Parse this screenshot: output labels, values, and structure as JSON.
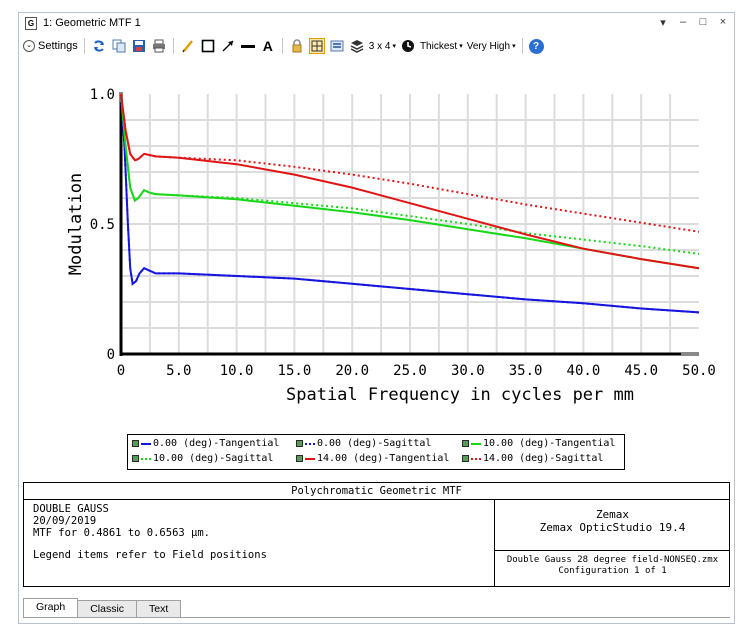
{
  "window": {
    "title": "1: Geometric MTF 1",
    "icon_letter": "G",
    "controls": [
      "▾",
      "–",
      "□",
      "×"
    ]
  },
  "toolbar": {
    "settings_label": "Settings",
    "layout_label": "3 x 4",
    "line_thickness": "Thickest",
    "quality": "Very High",
    "icons": [
      "refresh-icon",
      "copy-icon",
      "save-icon",
      "print-icon",
      "pencil-icon",
      "rectangle-icon",
      "arrow-icon",
      "line-icon",
      "text-icon",
      "lock-icon",
      "grid-icon",
      "export-icon",
      "layers-icon",
      "layout-icon",
      "clock-icon",
      "help-icon"
    ]
  },
  "chart_data": {
    "type": "line",
    "title": "",
    "xlabel": "Spatial Frequency in cycles per mm",
    "ylabel": "Modulation",
    "xlim": [
      0,
      50
    ],
    "ylim": [
      0,
      1
    ],
    "xticks": [
      "0",
      "5.0",
      "10.0",
      "15.0",
      "20.0",
      "25.0",
      "30.0",
      "35.0",
      "40.0",
      "45.0",
      "50.0"
    ],
    "yticks": [
      "0",
      "0.5",
      "1.0"
    ],
    "grid": true,
    "series": [
      {
        "name": "0.00 (deg)-Tangential",
        "color": "#1515e0",
        "dash": false,
        "x": [
          0,
          0.3,
          0.6,
          0.8,
          1.0,
          1.3,
          1.6,
          2.0,
          2.5,
          3,
          5,
          10,
          15,
          20,
          25,
          30,
          35,
          40,
          45,
          50
        ],
        "y": [
          1.0,
          0.8,
          0.5,
          0.33,
          0.27,
          0.28,
          0.31,
          0.33,
          0.32,
          0.31,
          0.31,
          0.3,
          0.29,
          0.27,
          0.25,
          0.23,
          0.21,
          0.195,
          0.175,
          0.16
        ]
      },
      {
        "name": "0.00 (deg)-Sagittal",
        "color": "#1515e0",
        "dash": true,
        "x": [
          0,
          0.3,
          0.6,
          0.8,
          1.0,
          1.3,
          1.6,
          2.0,
          2.5,
          3,
          5,
          10,
          15,
          20,
          25,
          30,
          35,
          40,
          45,
          50
        ],
        "y": [
          1.0,
          0.8,
          0.5,
          0.33,
          0.27,
          0.28,
          0.31,
          0.33,
          0.32,
          0.31,
          0.31,
          0.3,
          0.29,
          0.27,
          0.25,
          0.23,
          0.21,
          0.195,
          0.175,
          0.16
        ]
      },
      {
        "name": "10.00 (deg)-Tangential",
        "color": "#16d816",
        "dash": false,
        "x": [
          0,
          0.4,
          0.8,
          1.2,
          1.5,
          2.0,
          2.5,
          3,
          5,
          10,
          15,
          20,
          25,
          30,
          35,
          40,
          45,
          50
        ],
        "y": [
          1.0,
          0.8,
          0.64,
          0.59,
          0.6,
          0.63,
          0.62,
          0.615,
          0.61,
          0.595,
          0.57,
          0.545,
          0.515,
          0.48,
          0.445,
          0.405,
          0.365,
          0.33
        ]
      },
      {
        "name": "10.00 (deg)-Sagittal",
        "color": "#16d816",
        "dash": true,
        "x": [
          0,
          0.4,
          0.8,
          1.2,
          1.5,
          2.0,
          2.5,
          3,
          5,
          10,
          15,
          20,
          25,
          30,
          35,
          40,
          45,
          50
        ],
        "y": [
          1.0,
          0.8,
          0.64,
          0.59,
          0.6,
          0.63,
          0.62,
          0.615,
          0.61,
          0.6,
          0.58,
          0.56,
          0.53,
          0.5,
          0.465,
          0.44,
          0.415,
          0.385
        ]
      },
      {
        "name": "14.00 (deg)-Tangential",
        "color": "#e01414",
        "dash": false,
        "x": [
          0,
          0.4,
          0.8,
          1.2,
          1.5,
          2.0,
          2.5,
          3,
          5,
          10,
          15,
          20,
          25,
          30,
          35,
          40,
          45,
          50
        ],
        "y": [
          1.0,
          0.86,
          0.77,
          0.745,
          0.75,
          0.77,
          0.765,
          0.76,
          0.755,
          0.73,
          0.69,
          0.64,
          0.58,
          0.52,
          0.46,
          0.405,
          0.365,
          0.33
        ]
      },
      {
        "name": "14.00 (deg)-Sagittal",
        "color": "#e01414",
        "dash": true,
        "x": [
          0,
          0.4,
          0.8,
          1.2,
          1.5,
          2.0,
          2.5,
          3,
          5,
          10,
          15,
          20,
          25,
          30,
          35,
          40,
          45,
          50
        ],
        "y": [
          1.0,
          0.86,
          0.77,
          0.745,
          0.75,
          0.77,
          0.765,
          0.76,
          0.755,
          0.745,
          0.72,
          0.69,
          0.655,
          0.615,
          0.575,
          0.54,
          0.505,
          0.47
        ]
      }
    ]
  },
  "info": {
    "header": "Polychromatic Geometric MTF",
    "lines": [
      "DOUBLE GAUSS",
      "20/09/2019",
      "MTF for 0.4861 to 0.6563 µm."
    ],
    "note": "Legend items refer to Field positions",
    "vendor": "Zemax",
    "product": "Zemax OpticStudio 19.4",
    "file": "Double Gauss 28 degree field-NONSEQ.zmx",
    "config": "Configuration 1 of 1"
  },
  "tabs": [
    "Graph",
    "Classic",
    "Text"
  ]
}
